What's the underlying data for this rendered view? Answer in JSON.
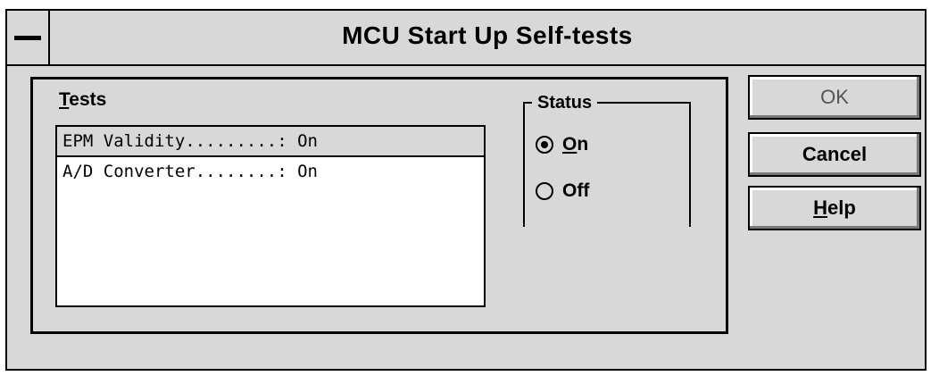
{
  "window": {
    "title": "MCU Start Up Self-tests"
  },
  "tests": {
    "label_accel": "T",
    "label_rest": "ests",
    "items": [
      "EPM Validity.........: On",
      "A/D Converter........: On"
    ]
  },
  "status": {
    "label": "Status",
    "on_accel": "O",
    "on_rest": "n",
    "off_label": "Off",
    "selected": "On"
  },
  "buttons": {
    "ok": "OK",
    "cancel": "Cancel",
    "help_accel": "H",
    "help_rest": "elp"
  }
}
